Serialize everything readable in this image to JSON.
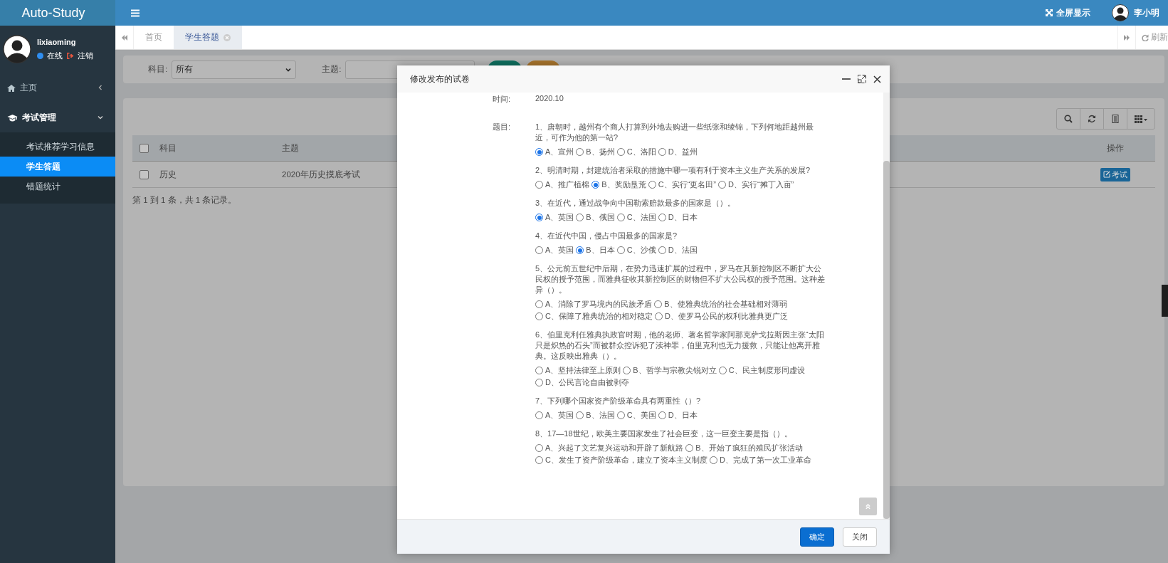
{
  "app": {
    "title": "Auto-Study"
  },
  "topbar": {
    "fullscreen": "全屏显示",
    "user": "李小明"
  },
  "sidebar": {
    "username": "lixiaoming",
    "status": "在线",
    "logout": "注销",
    "items": [
      {
        "label": "主页",
        "kind": "link",
        "expanded": false
      },
      {
        "label": "考试管理",
        "kind": "group",
        "expanded": true,
        "children": [
          {
            "label": "考试推荐学习信息",
            "selected": false
          },
          {
            "label": "学生答题",
            "selected": true
          },
          {
            "label": "错题统计",
            "selected": false
          }
        ]
      }
    ]
  },
  "tabs": [
    {
      "label": "首页",
      "selected": false,
      "closable": false
    },
    {
      "label": "学生答题",
      "selected": true,
      "closable": true
    }
  ],
  "refresh": "刷新",
  "filter": {
    "subject_label": "科目:",
    "subject_value": "所有",
    "topic_label": "主题:"
  },
  "table": {
    "select_all_checked": false,
    "columns": [
      "科目",
      "主题",
      "操作"
    ],
    "rows": [
      {
        "checked": false,
        "cells": [
          "历史",
          "2020年历史摸底考试"
        ],
        "action": "考试"
      }
    ]
  },
  "pagination": "第 1 到 1 条，共 1 条记录。",
  "modal": {
    "title": "修改发布的试卷",
    "time_label": "时间:",
    "time_value": "2020.10",
    "questions_label": "题目:",
    "questions": [
      {
        "text": "1、唐朝时，越州有个商人打算到外地去购进一些纸张和绫锦，下列何地距越州最近，可作为他的第一站?",
        "options": [
          {
            "label": "A、宣州",
            "selected": true
          },
          {
            "label": "B、扬州",
            "selected": false
          },
          {
            "label": "C、洛阳",
            "selected": false
          },
          {
            "label": "D、益州",
            "selected": false
          }
        ]
      },
      {
        "text": "2、明清时期，封建统治者采取的措施中哪一项有利于资本主义生产关系的发展?",
        "options": [
          {
            "label": "A、推广植棉",
            "selected": false
          },
          {
            "label": "B、奖励垦荒",
            "selected": true
          },
          {
            "label": "C、实行“更名田”",
            "selected": false
          },
          {
            "label": "D、实行“摊丁入亩”",
            "selected": false
          }
        ]
      },
      {
        "text": "3、在近代，通过战争向中国勒索赔款最多的国家是（）。",
        "options": [
          {
            "label": "A、英国",
            "selected": true
          },
          {
            "label": "B、俄国",
            "selected": false
          },
          {
            "label": "C、法国",
            "selected": false
          },
          {
            "label": "D、日本",
            "selected": false
          }
        ]
      },
      {
        "text": "4、在近代中国，侵占中国最多的国家是?",
        "options": [
          {
            "label": "A、英国",
            "selected": false
          },
          {
            "label": "B、日本",
            "selected": true
          },
          {
            "label": "C、沙俄",
            "selected": false
          },
          {
            "label": "D、法国",
            "selected": false
          }
        ]
      },
      {
        "text": "5、公元前五世纪中后期，在势力迅速扩展的过程中，罗马在其新控制区不断扩大公民权的授予范围，而雅典征收其新控制区的财物但不扩大公民权的授予范围。这种差异（）。",
        "options": [
          {
            "label": "A、消除了罗马境内的民族矛盾",
            "selected": false
          },
          {
            "label": "B、使雅典统治的社会基础相对薄弱",
            "selected": false
          },
          {
            "label": "C、保障了雅典统治的相对稳定",
            "selected": false
          },
          {
            "label": "D、使罗马公民的权利比雅典更广泛",
            "selected": false
          }
        ]
      },
      {
        "text": "6、伯里克利任雅典执政官时期，他的老师、著名哲学家阿那克萨戈拉斯因主张“太阳只是炽热的石头”而被群众控诉犯了渎神罪，伯里克利也无力援救，只能让他离开雅典。这反映出雅典（）。",
        "options": [
          {
            "label": "A、坚持法律至上原则",
            "selected": false
          },
          {
            "label": "B、哲学与宗教尖锐对立",
            "selected": false
          },
          {
            "label": "C、民主制度形同虚设",
            "selected": false
          },
          {
            "label": "D、公民言论自由被剥夺",
            "selected": false
          }
        ]
      },
      {
        "text": "7、下列哪个国家资产阶级革命具有两重性（）?",
        "options": [
          {
            "label": "A、英国",
            "selected": false
          },
          {
            "label": "B、法国",
            "selected": false
          },
          {
            "label": "C、美国",
            "selected": false
          },
          {
            "label": "D、日本",
            "selected": false
          }
        ]
      },
      {
        "text": "8、17—18世纪，欧美主要国家发生了社会巨变，这一巨变主要是指（）。",
        "options": [
          {
            "label": "A、兴起了文艺复兴运动和开辟了新航路",
            "selected": false
          },
          {
            "label": "B、开始了疯狂的殖民扩张活动",
            "selected": false
          },
          {
            "label": "C、发生了资产阶级革命，建立了资本主义制度",
            "selected": false
          },
          {
            "label": "D、完成了第一次工业革命",
            "selected": false
          }
        ]
      }
    ],
    "buttons": [
      {
        "label": "确定",
        "kind": "primary"
      },
      {
        "label": "关闭",
        "kind": "default"
      }
    ]
  }
}
